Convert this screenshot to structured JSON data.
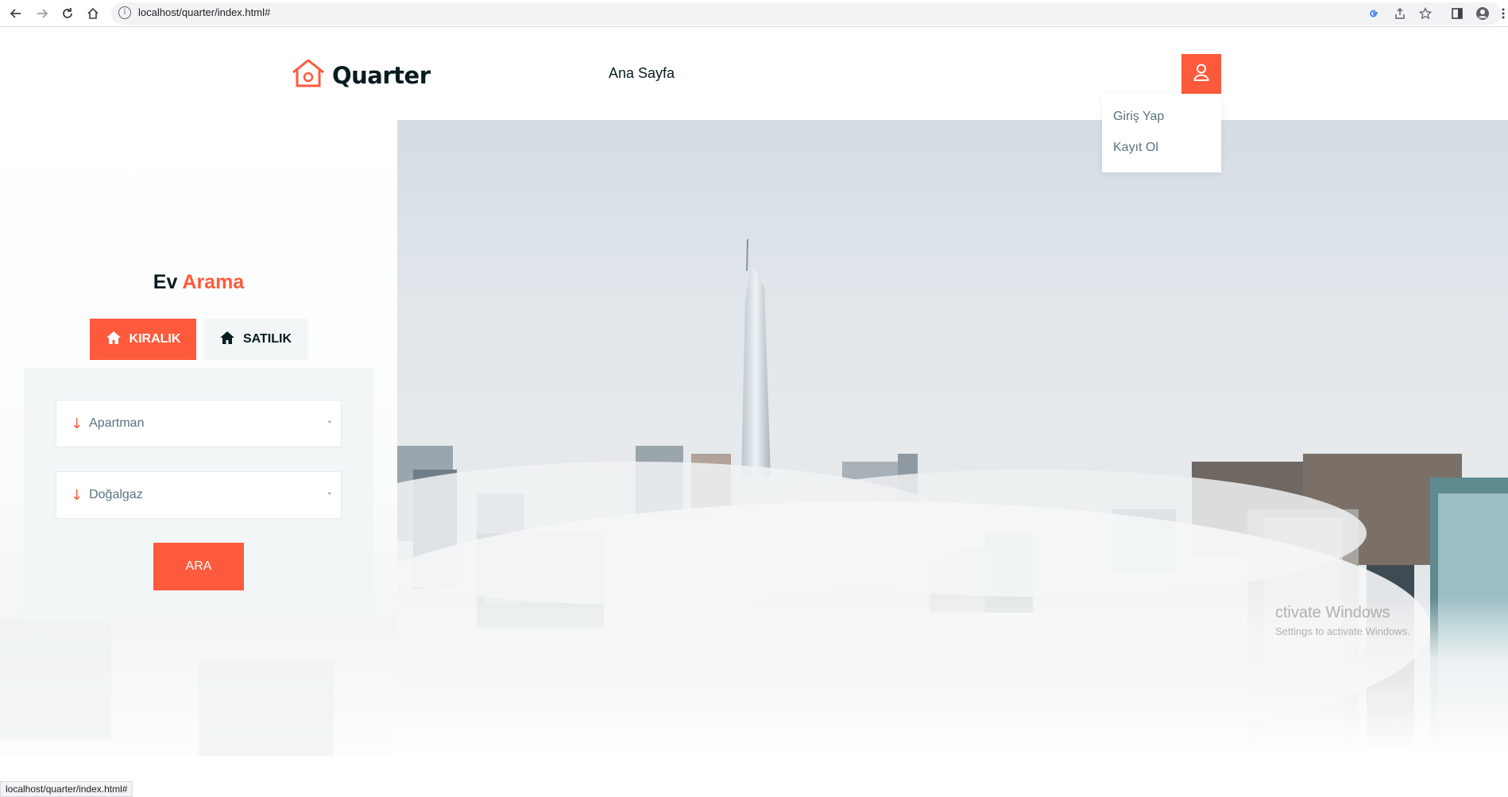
{
  "browser": {
    "url": "localhost/quarter/index.html#",
    "status_url": "localhost/quarter/index.html#"
  },
  "header": {
    "brand": "Quarter",
    "nav_home": "Ana Sayfa",
    "user_menu": [
      "Giriş Yap",
      "Kayıt Ol"
    ]
  },
  "search": {
    "title_plain": "Ev",
    "title_accent": "Arama",
    "tab_rent": "KIRALIK",
    "tab_sale": "SATILIK",
    "select_type": "Apartman",
    "select_heating": "Doğalgaz",
    "submit": "ARA"
  },
  "watermark": {
    "line1": "ctivate Windows",
    "line2": "Settings to activate Windows."
  },
  "colors": {
    "accent": "#ff5a3c",
    "dark": "#071c1f",
    "muted": "#5c727d",
    "panel": "#f2f6f7"
  }
}
